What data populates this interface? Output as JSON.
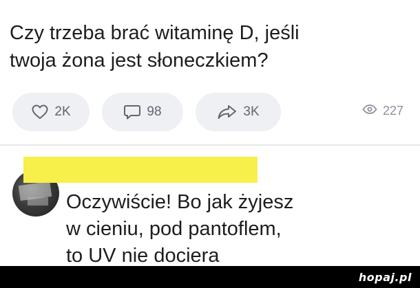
{
  "post": {
    "text_line1": "Czy trzeba brać witaminę D, jeśli",
    "text_line2": "twoja żona jest słoneczkiem?"
  },
  "actions": {
    "likes": "2K",
    "comments": "98",
    "shares": "3K",
    "views": "227"
  },
  "comment": {
    "author_redacted": true,
    "text_line1": "Oczywiście! Bo jak żyjesz",
    "text_line2": "w cieniu, pod pantoflem,",
    "text_line3": "to UV nie dociera"
  },
  "watermark": {
    "text": "hopaj.pl"
  },
  "colors": {
    "pill_bg": "#eef0f3",
    "redaction": "#f7ef4a",
    "footer": "#000000"
  },
  "icons": [
    "heart-icon",
    "comment-bubble-icon",
    "share-arrow-icon",
    "eye-icon"
  ]
}
